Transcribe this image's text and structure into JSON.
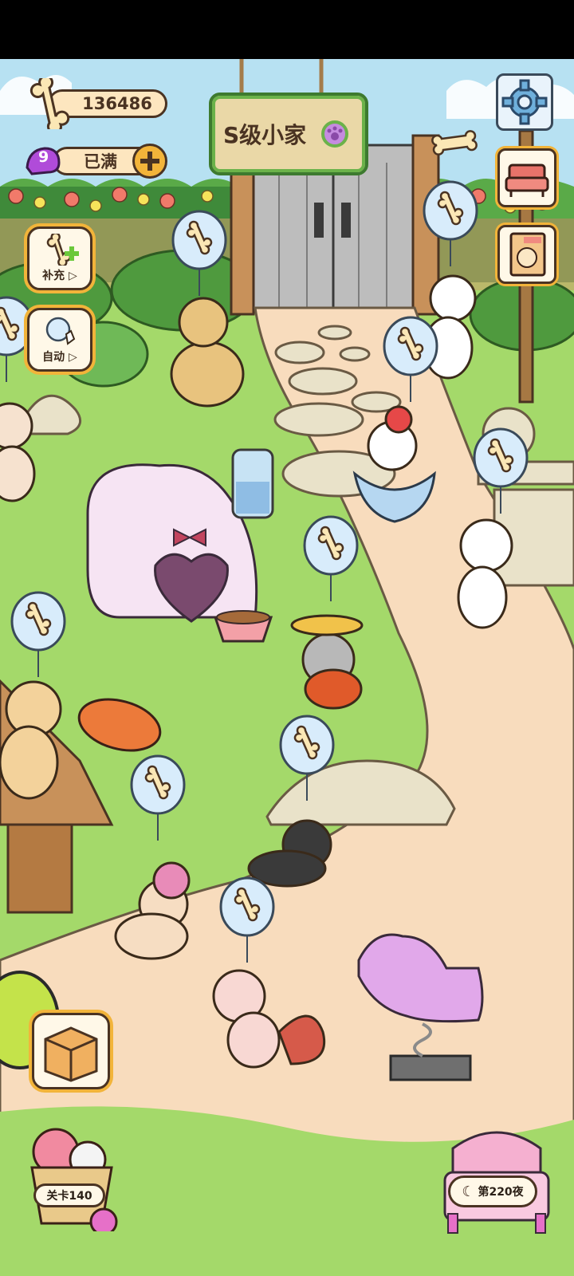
{
  "hud": {
    "bones_count": "136486",
    "level_number": "9",
    "energy_status": "已满",
    "house_title": "S级小家",
    "refill_label": "补充",
    "auto_label": "自动",
    "stage_label": "关卡140",
    "night_label": "第220夜"
  },
  "icons": {
    "bone": "bone-icon",
    "plus": "plus-icon",
    "settings": "gear-icon",
    "furniture": "sofa-icon",
    "album": "dog-book-icon",
    "box": "cardboard-box-icon",
    "moon": "moon-icon",
    "yarn": "yarn-ball-icon"
  },
  "colors": {
    "sky": "#b7e1f2",
    "grass": "#a4d96a",
    "path": "#f8dcbd",
    "pill_bg": "#fde6bf",
    "outline": "#4a3322",
    "accent_orange": "#f2b43a",
    "level_purple": "#b04bd9"
  }
}
